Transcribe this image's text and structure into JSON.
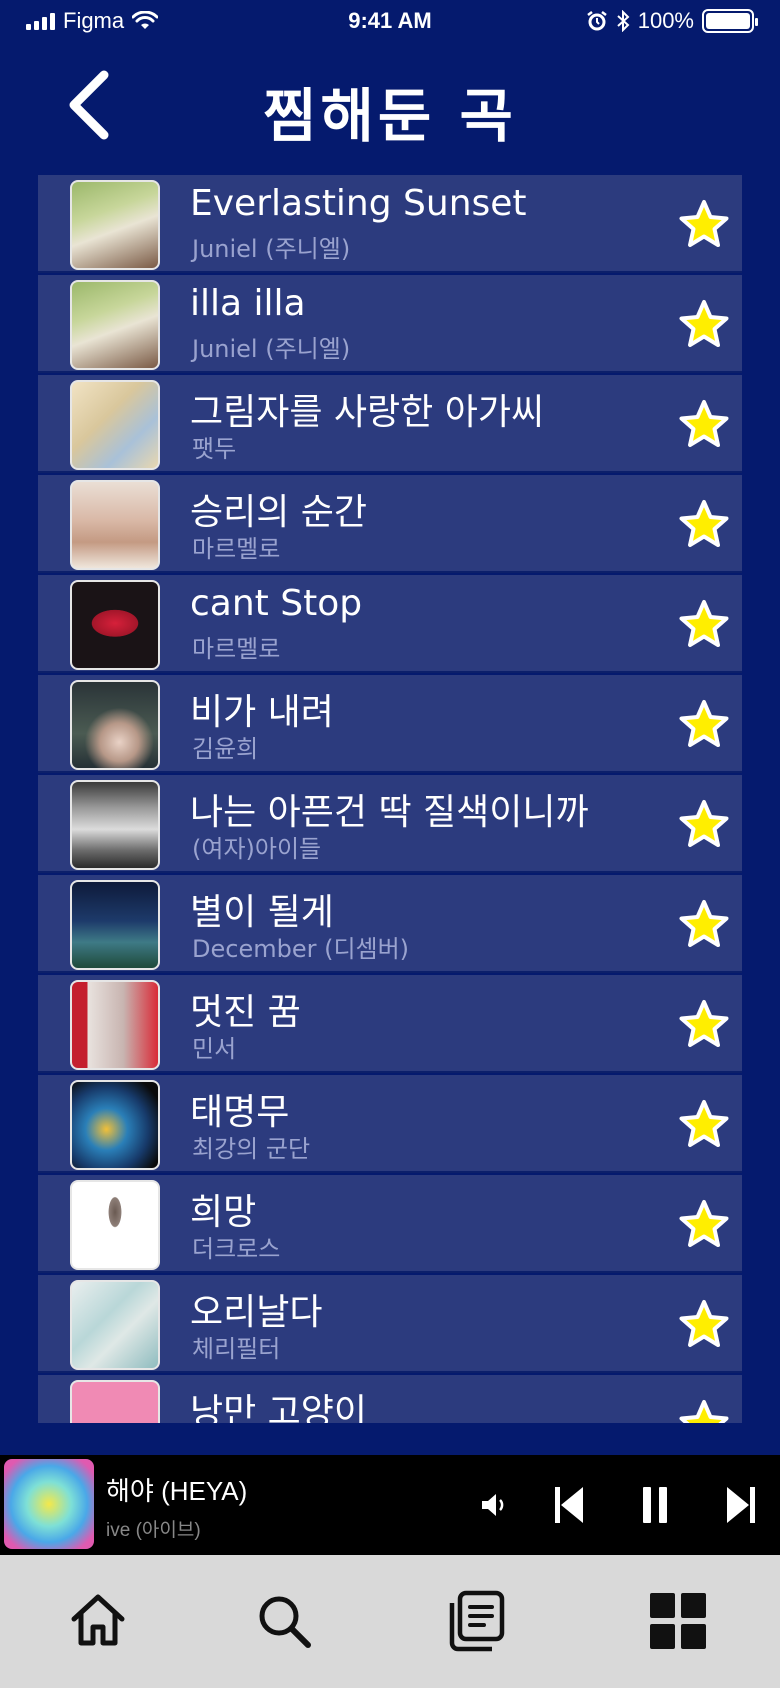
{
  "status": {
    "carrier": "Figma",
    "time": "9:41 AM",
    "battery": "100%"
  },
  "header": {
    "title": "찜해둔 곡"
  },
  "songs": [
    {
      "title": "Everlasting Sunset",
      "artist": "Juniel (주니엘)"
    },
    {
      "title": "illa illa",
      "artist": "Juniel (주니엘)"
    },
    {
      "title": "그림자를 사랑한 아가씨",
      "artist": "팻두"
    },
    {
      "title": "승리의 순간",
      "artist": "마르멜로"
    },
    {
      "title": "cant Stop",
      "artist": "마르멜로"
    },
    {
      "title": "비가 내려",
      "artist": "김윤희"
    },
    {
      "title": "나는 아픈건 딱 질색이니까",
      "artist": "(여자)아이들"
    },
    {
      "title": "별이 될게",
      "artist": "December (디셈버)"
    },
    {
      "title": "멋진 꿈",
      "artist": "민서"
    },
    {
      "title": "태명무",
      "artist": "최강의 군단"
    },
    {
      "title": "희망",
      "artist": "더크로스"
    },
    {
      "title": "오리날다",
      "artist": "체리필터"
    },
    {
      "title": "낭만 고양이",
      "artist": ""
    }
  ],
  "player": {
    "title": "해야 (HEYA)",
    "artist": "ive (아이브)"
  },
  "colors": {
    "background": "#051a6e",
    "row": "#2c3b7e",
    "star": "#ffee00",
    "tabbar": "#d9d9d9"
  }
}
